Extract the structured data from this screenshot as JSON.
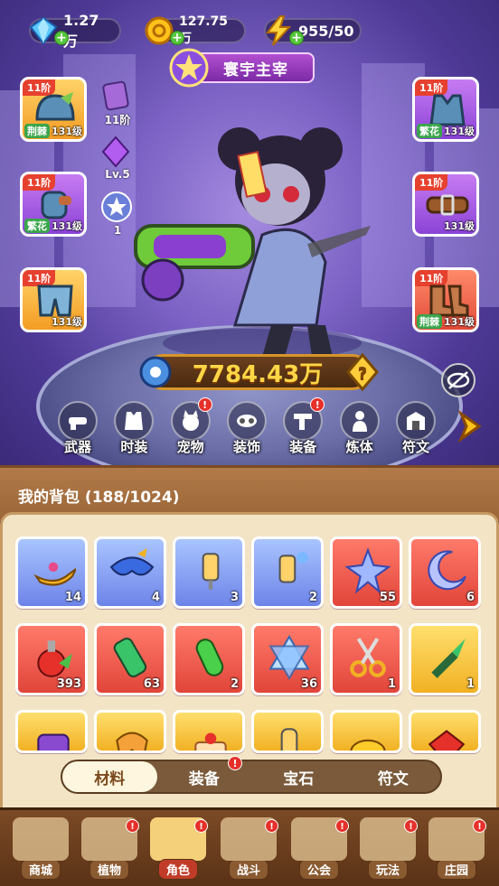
{
  "resources": {
    "gems": "1.27万",
    "coins": "127.75万",
    "energy": "955/50"
  },
  "hero": {
    "title": "寰宇主宰",
    "power": "7784.43万"
  },
  "left_slots": [
    {
      "tier": "11阶",
      "tag": "荆棘",
      "level": "131级",
      "color": "orange",
      "icon": "helmet-icon"
    },
    {
      "tier": "11阶",
      "tag": "繁花",
      "level": "131级",
      "color": "purple",
      "icon": "glove-icon"
    },
    {
      "tier": "11阶",
      "tag": "",
      "level": "131级",
      "color": "orange",
      "icon": "shorts-icon"
    }
  ],
  "right_slots": [
    {
      "tier": "11阶",
      "tag": "繁花",
      "level": "131级",
      "color": "purple",
      "icon": "vest-icon"
    },
    {
      "tier": "11阶",
      "tag": "",
      "level": "131级",
      "color": "purple",
      "icon": "belt-icon"
    },
    {
      "tier": "11阶",
      "tag": "荆棘",
      "level": "131级",
      "color": "red",
      "icon": "boots-icon"
    }
  ],
  "side_items": {
    "tier_label": "11阶",
    "gem_level": "Lv.5",
    "orb_count": "1"
  },
  "categories": [
    {
      "label": "武器",
      "icon": "weapon-icon",
      "badge": false
    },
    {
      "label": "时装",
      "icon": "fashion-icon",
      "badge": false
    },
    {
      "label": "宠物",
      "icon": "pet-icon",
      "badge": true
    },
    {
      "label": "装饰",
      "icon": "decoration-icon",
      "badge": false
    },
    {
      "label": "装备",
      "icon": "equipment-icon",
      "badge": true
    },
    {
      "label": "炼体",
      "icon": "training-icon",
      "badge": false
    },
    {
      "label": "符文",
      "icon": "rune-icon",
      "badge": false
    }
  ],
  "badge_mark": "!",
  "bag": {
    "title": "我的背包 (188/1024)",
    "items": [
      {
        "count": "14",
        "color": "blue",
        "icon": "magic-lamp-icon"
      },
      {
        "count": "4",
        "color": "blue",
        "icon": "mask-icon"
      },
      {
        "count": "3",
        "color": "blue",
        "icon": "syringe-icon"
      },
      {
        "count": "2",
        "color": "blue",
        "icon": "syringe-splash-icon"
      },
      {
        "count": "55",
        "color": "red",
        "icon": "star-crystal-icon"
      },
      {
        "count": "6",
        "color": "red",
        "icon": "moon-star-icon"
      },
      {
        "count": "393",
        "color": "red",
        "icon": "potion-icon"
      },
      {
        "count": "63",
        "color": "red",
        "icon": "tube-icon"
      },
      {
        "count": "2",
        "color": "red",
        "icon": "capsule-icon"
      },
      {
        "count": "36",
        "color": "red",
        "icon": "hexagram-icon"
      },
      {
        "count": "1",
        "color": "red",
        "icon": "scissors-icon"
      },
      {
        "count": "1",
        "color": "gold",
        "icon": "dart-icon"
      },
      {
        "count": "",
        "color": "gold",
        "icon": "dice-icon"
      },
      {
        "count": "",
        "color": "gold",
        "icon": "ribbon-icon"
      },
      {
        "count": "",
        "color": "gold",
        "icon": "cake-icon"
      },
      {
        "count": "",
        "color": "gold",
        "icon": "flask-icon"
      },
      {
        "count": "",
        "color": "gold",
        "icon": "gold-nugget-icon"
      },
      {
        "count": "",
        "color": "gold",
        "icon": "ruby-icon"
      }
    ]
  },
  "tabs": [
    {
      "label": "材料",
      "active": true,
      "badge": false
    },
    {
      "label": "装备",
      "active": false,
      "badge": true
    },
    {
      "label": "宝石",
      "active": false,
      "badge": false
    },
    {
      "label": "符文",
      "active": false,
      "badge": false
    }
  ],
  "nav": [
    {
      "label": "商城",
      "active": false,
      "badge": false
    },
    {
      "label": "植物",
      "active": false,
      "badge": true
    },
    {
      "label": "角色",
      "active": true,
      "badge": true
    },
    {
      "label": "战斗",
      "active": false,
      "badge": true
    },
    {
      "label": "公会",
      "active": false,
      "badge": true
    },
    {
      "label": "玩法",
      "active": false,
      "badge": true
    },
    {
      "label": "庄园",
      "active": false,
      "badge": true
    }
  ]
}
